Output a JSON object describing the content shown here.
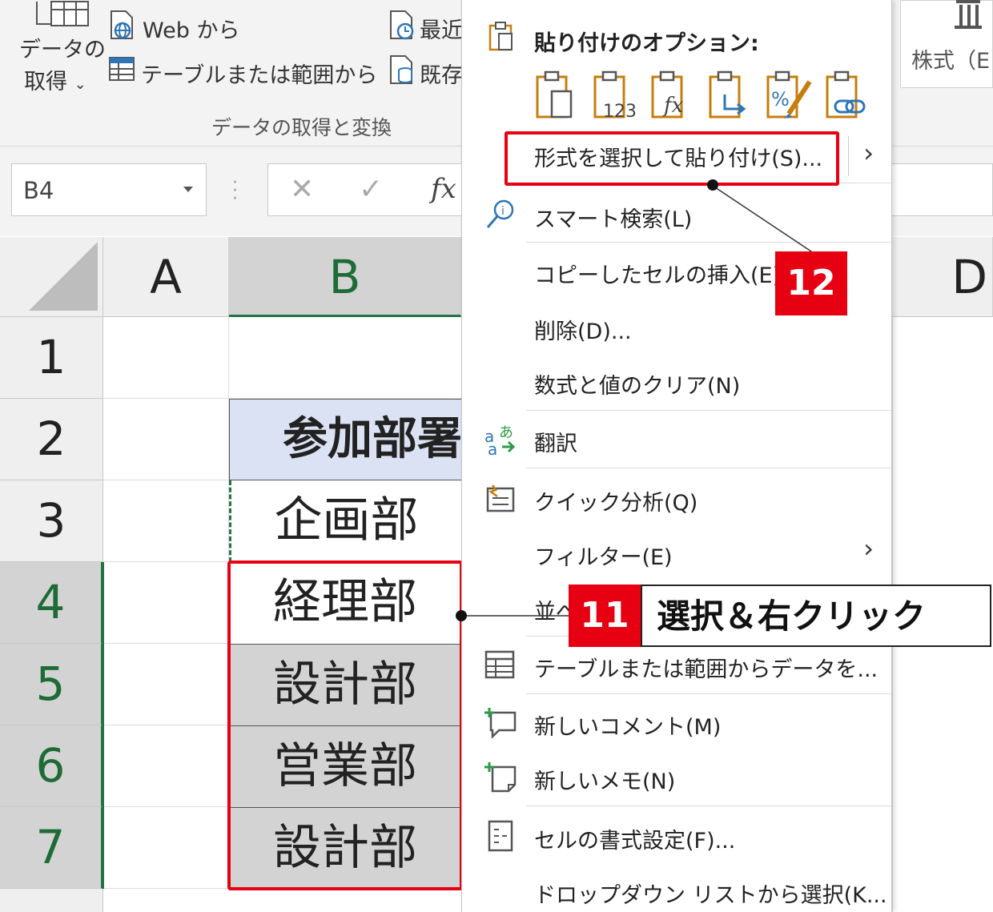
{
  "ribbon": {
    "get_data_line1": "データの",
    "get_data_line2": "取得",
    "web_label": "Web から",
    "table_range_label": "テーブルまたは範囲から",
    "recent_label": "最近",
    "existing_label": "既存",
    "group_label": "データの取得と変換",
    "stocks_label": "株式（E"
  },
  "formula_bar": {
    "name_box": "B4",
    "cancel_icon": "✕",
    "enter_icon": "✓",
    "fx_icon": "fx"
  },
  "grid": {
    "col_a": "A",
    "col_b": "B",
    "col_d": "D",
    "rows": [
      "1",
      "2",
      "3",
      "4",
      "5",
      "6",
      "7"
    ],
    "b2": "参加部署",
    "b3": "企画部",
    "b4": "経理部",
    "b5": "設計部",
    "b6": "営業部",
    "b7": "設計部"
  },
  "menu": {
    "paste_options_title": "貼り付けのオプション:",
    "paste_icon_123": "123",
    "paste_icon_fx": "fx",
    "items": [
      "形式を選択して貼り付け(S)...",
      "スマート検索(L)",
      "コピーしたセルの挿入(E)...",
      "削除(D)...",
      "数式と値のクリア(N)",
      "翻訳",
      "クイック分析(Q)",
      "フィルター(E)",
      "並べ",
      "テーブルまたは範囲からデータを...",
      "新しいコメント(M)",
      "新しいメモ(N)",
      "セルの書式設定(F)...",
      "ドロップダウン リストから選択(K..."
    ]
  },
  "annotations": {
    "step11_number": "11",
    "step11_text": "選択＆右クリック",
    "step12_number": "12"
  },
  "colors": {
    "annotation_red": "#e60012",
    "excel_green": "#217346",
    "header_fill": "#dbe2f3",
    "selected_fill": "#d3d3d3"
  }
}
